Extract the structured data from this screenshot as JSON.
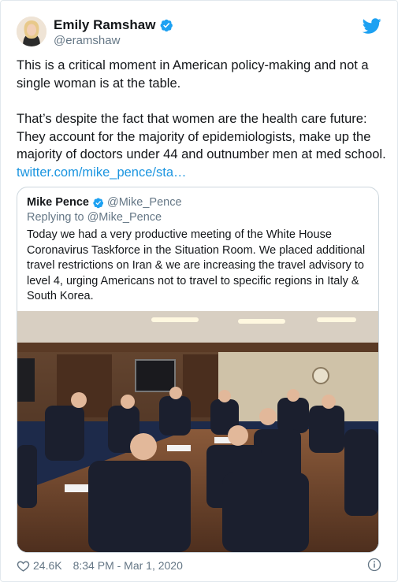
{
  "author": {
    "name": "Emily Ramshaw",
    "handle": "@eramshaw"
  },
  "tweet": {
    "paragraph_1": "This is a critical moment in American policy-making and not a single woman is at the table.",
    "paragraph_2": "That’s despite the fact that women are the health care future: They account for the majority of epidemiologists, make up the majority of doctors under 44 and outnumber men at med school.",
    "link": "twitter.com/mike_pence/sta…"
  },
  "quoted": {
    "name": "Mike Pence",
    "handle": "@Mike_Pence",
    "replying_to": "Replying to @Mike_Pence",
    "text": "Today we had a very productive meeting of the White House Coronavirus Taskforce in the Situation Room. We placed additional travel restrictions on Iran & we are increasing the travel advisory to level 4, urging Americans not to travel to specific regions in Italy & South Korea."
  },
  "footer": {
    "likes": "24.6K",
    "timestamp": "8:34 PM - Mar 1, 2020"
  },
  "icons": {
    "verified": "verified-badge-icon",
    "brand": "twitter-bird-icon",
    "like": "heart-icon",
    "info": "info-icon"
  },
  "colors": {
    "brand_blue": "#1da1f2",
    "link_blue": "#1b95e0",
    "secondary_text": "#657786"
  }
}
